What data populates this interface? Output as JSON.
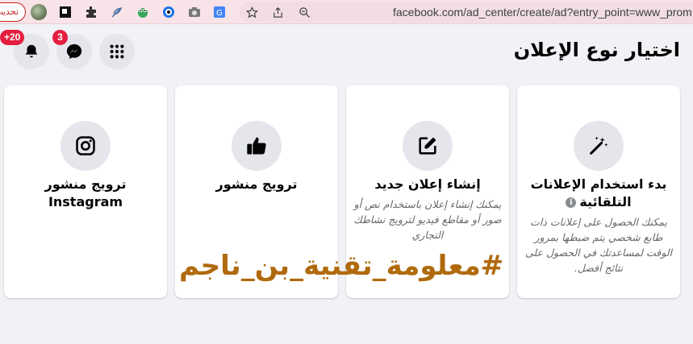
{
  "browser": {
    "update_label": "تحديث",
    "url": "facebook.com/ad_center/create/ad?entry_point=www_prom",
    "extensions": [
      "square-logo-icon",
      "puzzle-icon",
      "feather-icon",
      "frog-icon",
      "eye-icon",
      "camera-icon",
      "translate-icon"
    ]
  },
  "header": {
    "notifications_badge": "+20",
    "messenger_badge": "3"
  },
  "page": {
    "title": "اختيار نوع الإعلان"
  },
  "cards": [
    {
      "icon": "magic-wand-icon",
      "title": "بدء استخدام الإعلانات التلقائية",
      "description": "يمكنك الحصول على إعلانات ذات طابع شخصي يتم ضبطها بمرور الوقت لمساعدتك في الحصول على نتائج أفضل."
    },
    {
      "icon": "edit-icon",
      "title": "إنشاء إعلان جديد",
      "description": "يمكنك إنشاء إعلان باستخدام نص أو صور أو مقاطع فيديو لترويج نشاطك التجاري"
    },
    {
      "icon": "thumbs-up-icon",
      "title": "ترويج منشور",
      "description": ""
    },
    {
      "icon": "instagram-icon",
      "title": "ترويج منشور Instagram",
      "description": ""
    }
  ],
  "watermark": "#معلومة_تقنية_بن_ناجم",
  "colors": {
    "browser_bar": "#f8e3e8",
    "page_bg": "#f0f2f5",
    "badge": "#e41e3f",
    "watermark": "#b06a0c"
  }
}
